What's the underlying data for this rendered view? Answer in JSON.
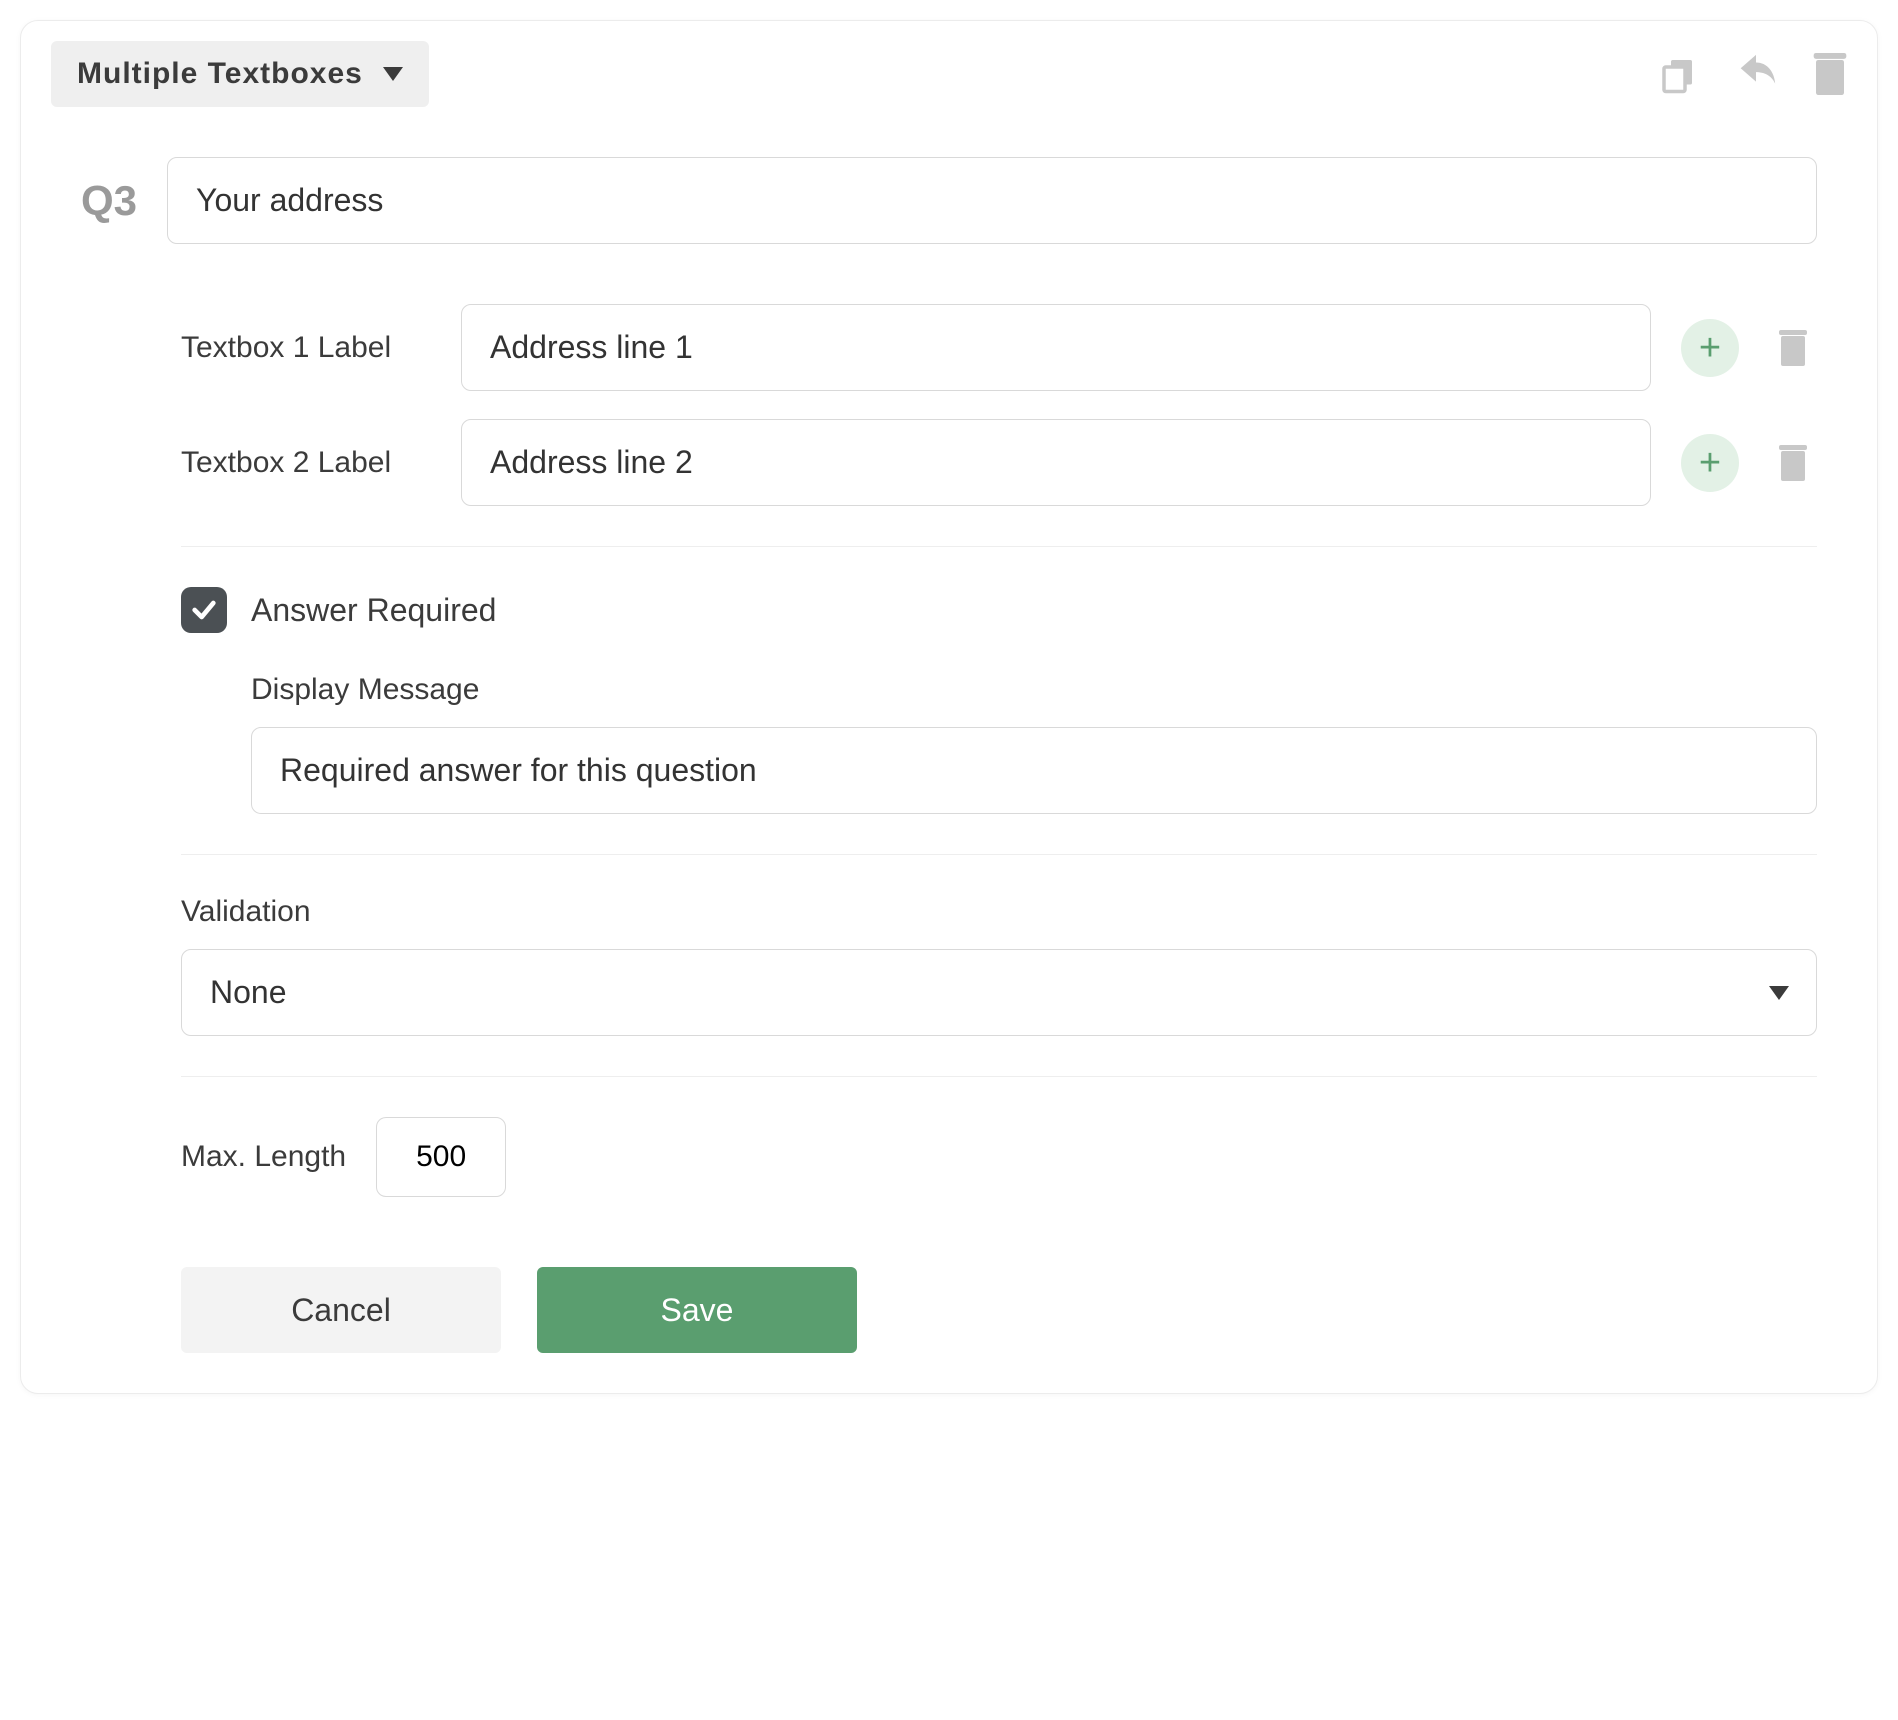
{
  "header": {
    "question_type": "Multiple Textboxes"
  },
  "question": {
    "number": "Q3",
    "title": "Your address"
  },
  "textboxes": [
    {
      "label_prefix": "Textbox 1 Label",
      "value": "Address line 1"
    },
    {
      "label_prefix": "Textbox 2 Label",
      "value": "Address line 2"
    }
  ],
  "required": {
    "checked": true,
    "label": "Answer Required",
    "display_message_label": "Display Message",
    "display_message_value": "Required answer for this question"
  },
  "validation": {
    "label": "Validation",
    "selected": "None"
  },
  "max_length": {
    "label": "Max. Length",
    "value": "500"
  },
  "footer": {
    "cancel": "Cancel",
    "save": "Save"
  }
}
